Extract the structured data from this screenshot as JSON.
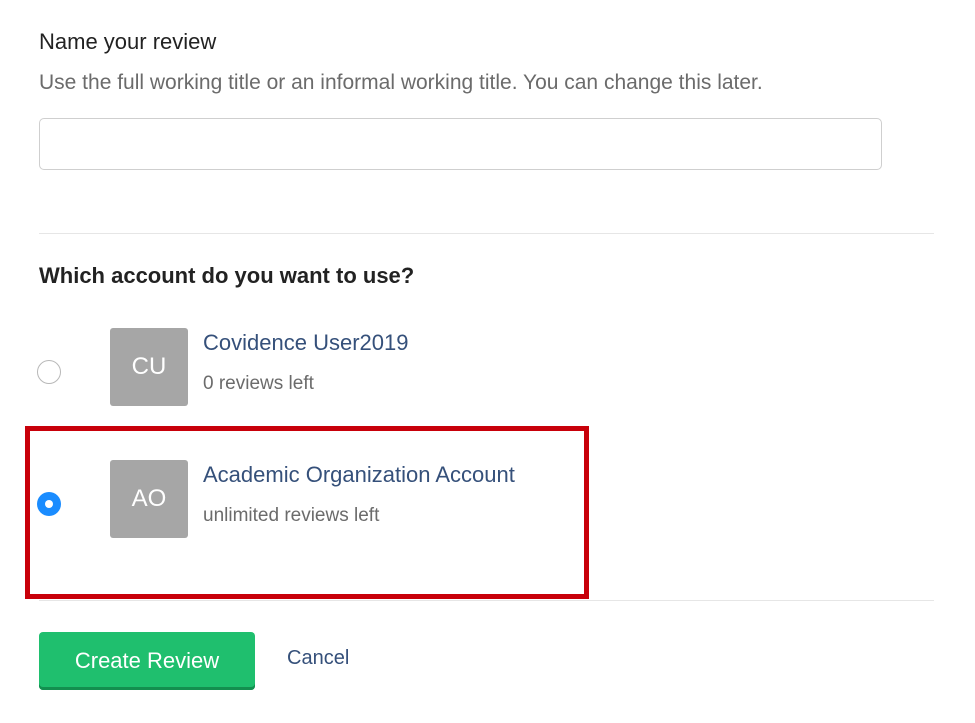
{
  "review_name": {
    "label": "Name your review",
    "help": "Use the full working title or an informal working title. You can change this later.",
    "value": "",
    "placeholder": ""
  },
  "account_selection": {
    "question": "Which account do you want to use?",
    "accounts": [
      {
        "initials": "CU",
        "name": "Covidence User2019",
        "reviews_left": "0 reviews left",
        "selected": false
      },
      {
        "initials": "AO",
        "name": "Academic Organization Account",
        "reviews_left": "unlimited reviews left",
        "selected": true
      }
    ]
  },
  "actions": {
    "create_label": "Create Review",
    "cancel_label": "Cancel"
  },
  "colors": {
    "primary_button": "#1fbf6e",
    "link": "#35507a",
    "radio_selected": "#1a8cff",
    "highlight": "#c8000a",
    "avatar": "#a6a6a6"
  }
}
